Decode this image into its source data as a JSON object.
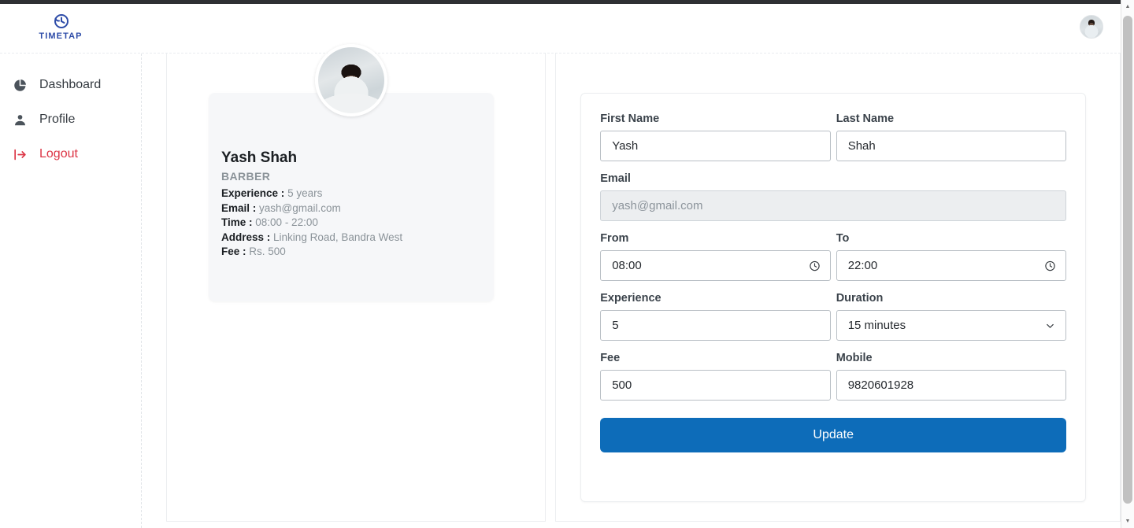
{
  "brand": {
    "name": "TIMETAP",
    "logo_icon": "clock-icon",
    "color": "#2e4ca8"
  },
  "header": {
    "avatar_icon": "user-avatar"
  },
  "sidebar": {
    "items": [
      {
        "label": "Dashboard",
        "icon": "pie-chart-icon",
        "key": "dashboard"
      },
      {
        "label": "Profile",
        "icon": "user-icon",
        "key": "profile"
      },
      {
        "label": "Logout",
        "icon": "logout-icon",
        "key": "logout",
        "color": "#dc3545"
      }
    ]
  },
  "profile_card": {
    "photo_icon": "profile-photo",
    "name": "Yash Shah",
    "role": "BARBER",
    "details": [
      {
        "label": "Experience :",
        "value": "5 years"
      },
      {
        "label": "Email :",
        "value": "yash@gmail.com"
      },
      {
        "label": "Time :",
        "value": "08:00 - 22:00"
      },
      {
        "label": "Address :",
        "value": "Linking Road, Bandra West"
      },
      {
        "label": "Fee :",
        "value": "Rs. 500"
      }
    ]
  },
  "form": {
    "first_name": {
      "label": "First Name",
      "value": "Yash"
    },
    "last_name": {
      "label": "Last Name",
      "value": "Shah"
    },
    "email": {
      "label": "Email",
      "value": "yash@gmail.com",
      "disabled": true
    },
    "from": {
      "label": "From",
      "value": "08:00",
      "icon": "clock-icon"
    },
    "to": {
      "label": "To",
      "value": "22:00",
      "icon": "clock-icon"
    },
    "experience": {
      "label": "Experience",
      "value": "5"
    },
    "duration": {
      "label": "Duration",
      "value": "15 minutes",
      "icon": "chevron-down-icon"
    },
    "fee": {
      "label": "Fee",
      "value": "500"
    },
    "mobile": {
      "label": "Mobile",
      "value": "9820601928"
    },
    "submit_label": "Update",
    "submit_color": "#0d6cb9"
  }
}
